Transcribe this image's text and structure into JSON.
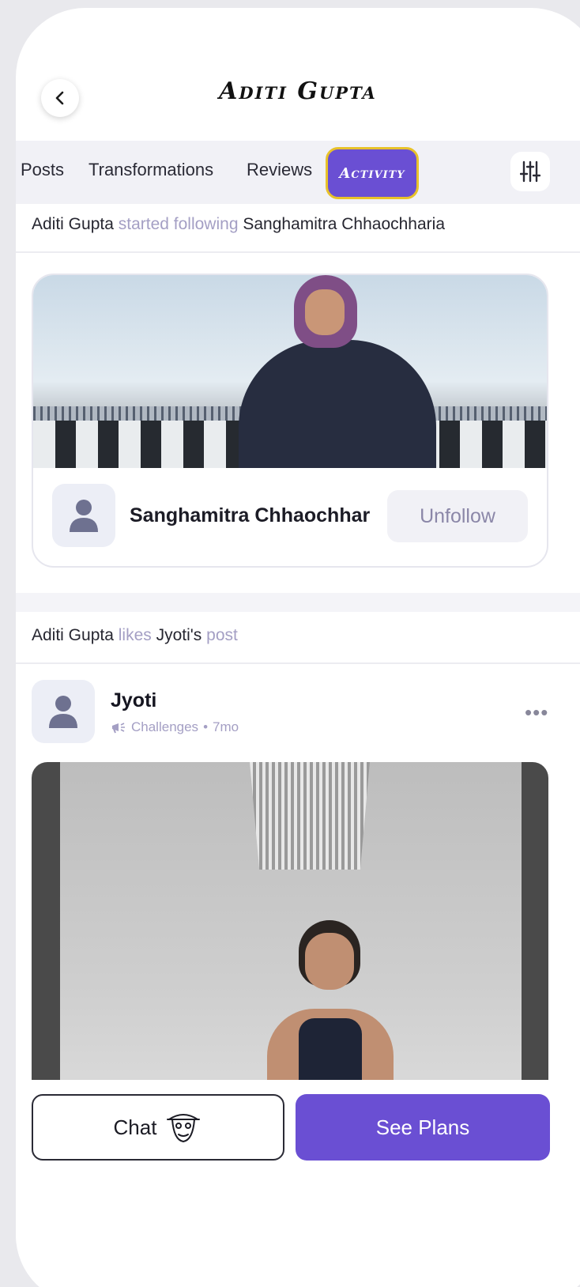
{
  "header": {
    "title": "Aditi Gupta",
    "back_icon": "chevron-left-icon"
  },
  "tabs": [
    {
      "label": "Posts",
      "active": false
    },
    {
      "label": "Transformations",
      "active": false
    },
    {
      "label": "Reviews",
      "active": false
    },
    {
      "label": "Activity",
      "active": true
    }
  ],
  "filter_icon": "sliders-icon",
  "activity_1": {
    "actor": "Aditi Gupta",
    "verb": "started following",
    "target": "Sanghamitra Chhaochharia",
    "card": {
      "name": "Sanghamitra Chhaochhar",
      "button_label": "Unfollow"
    }
  },
  "activity_2": {
    "actor": "Aditi Gupta",
    "verb": "likes",
    "target": "Jyoti's",
    "suffix": "post",
    "post": {
      "author": "Jyoti",
      "category": "Challenges",
      "age": "7mo",
      "separator": "•"
    }
  },
  "bottom": {
    "chat_label": "Chat",
    "plans_label": "See Plans"
  },
  "colors": {
    "accent": "#6a4fd3",
    "active_tab_border": "#e8c22a",
    "muted_text": "#a49fc4"
  }
}
